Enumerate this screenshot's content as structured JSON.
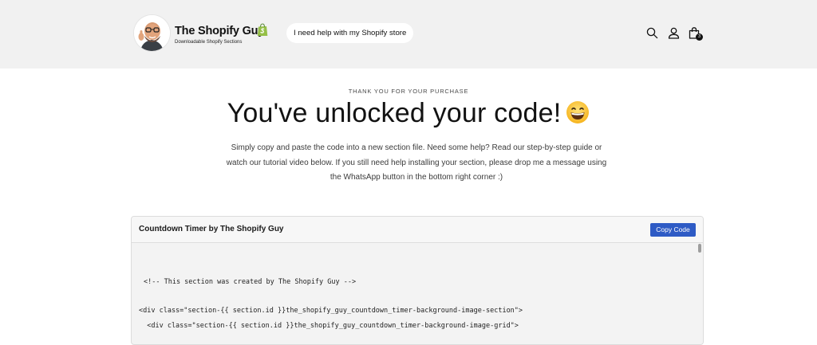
{
  "header": {
    "brand_name": "The Shopify Guy",
    "brand_tagline": "Downloadable Shopify Sections",
    "help_pill_label": "I need help with my Shopify store",
    "cart_count": "3",
    "icons": [
      "search-icon",
      "account-icon",
      "cart-icon"
    ]
  },
  "hero": {
    "eyebrow": "THANK YOU FOR YOUR PURCHASE",
    "title": "You've unlocked your code!",
    "emoji": "grinning-face",
    "description": "Simply copy and paste the code into a new section file. Need some help? Read our step-by-step guide or watch our tutorial video below. If you still need help installing your section, please drop me a message using the WhatsApp button in the bottom right corner :)"
  },
  "code_card": {
    "title": "Countdown Timer by The Shopify Guy",
    "copy_label": "Copy Code",
    "lines": [
      "<!-- This section was created by The Shopify Guy -->",
      "<div class=\"section-{{ section.id }}the_shopify_guy_countdown_timer-background-image-section\">",
      "  <div class=\"section-{{ section.id }}the_shopify_guy_countdown_timer-background-image-grid\">"
    ]
  },
  "colors": {
    "header_bg": "#f1f1f1",
    "button_blue": "#2e5bc5",
    "shopify_green": "#95bf47",
    "text_dark": "#121212"
  }
}
